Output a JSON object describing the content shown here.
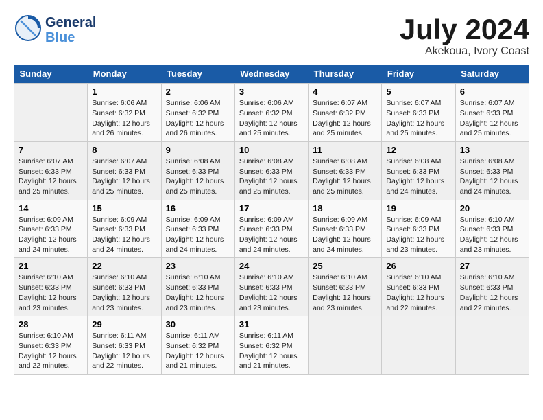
{
  "header": {
    "logo_line1": "General",
    "logo_line2": "Blue",
    "month_title": "July 2024",
    "location": "Akekoua, Ivory Coast"
  },
  "days_of_week": [
    "Sunday",
    "Monday",
    "Tuesday",
    "Wednesday",
    "Thursday",
    "Friday",
    "Saturday"
  ],
  "weeks": [
    [
      {
        "day": "",
        "sunrise": "",
        "sunset": "",
        "daylight": ""
      },
      {
        "day": "1",
        "sunrise": "Sunrise: 6:06 AM",
        "sunset": "Sunset: 6:32 PM",
        "daylight": "Daylight: 12 hours and 26 minutes."
      },
      {
        "day": "2",
        "sunrise": "Sunrise: 6:06 AM",
        "sunset": "Sunset: 6:32 PM",
        "daylight": "Daylight: 12 hours and 26 minutes."
      },
      {
        "day": "3",
        "sunrise": "Sunrise: 6:06 AM",
        "sunset": "Sunset: 6:32 PM",
        "daylight": "Daylight: 12 hours and 25 minutes."
      },
      {
        "day": "4",
        "sunrise": "Sunrise: 6:07 AM",
        "sunset": "Sunset: 6:32 PM",
        "daylight": "Daylight: 12 hours and 25 minutes."
      },
      {
        "day": "5",
        "sunrise": "Sunrise: 6:07 AM",
        "sunset": "Sunset: 6:33 PM",
        "daylight": "Daylight: 12 hours and 25 minutes."
      },
      {
        "day": "6",
        "sunrise": "Sunrise: 6:07 AM",
        "sunset": "Sunset: 6:33 PM",
        "daylight": "Daylight: 12 hours and 25 minutes."
      }
    ],
    [
      {
        "day": "7",
        "sunrise": "Sunrise: 6:07 AM",
        "sunset": "Sunset: 6:33 PM",
        "daylight": "Daylight: 12 hours and 25 minutes."
      },
      {
        "day": "8",
        "sunrise": "Sunrise: 6:07 AM",
        "sunset": "Sunset: 6:33 PM",
        "daylight": "Daylight: 12 hours and 25 minutes."
      },
      {
        "day": "9",
        "sunrise": "Sunrise: 6:08 AM",
        "sunset": "Sunset: 6:33 PM",
        "daylight": "Daylight: 12 hours and 25 minutes."
      },
      {
        "day": "10",
        "sunrise": "Sunrise: 6:08 AM",
        "sunset": "Sunset: 6:33 PM",
        "daylight": "Daylight: 12 hours and 25 minutes."
      },
      {
        "day": "11",
        "sunrise": "Sunrise: 6:08 AM",
        "sunset": "Sunset: 6:33 PM",
        "daylight": "Daylight: 12 hours and 25 minutes."
      },
      {
        "day": "12",
        "sunrise": "Sunrise: 6:08 AM",
        "sunset": "Sunset: 6:33 PM",
        "daylight": "Daylight: 12 hours and 24 minutes."
      },
      {
        "day": "13",
        "sunrise": "Sunrise: 6:08 AM",
        "sunset": "Sunset: 6:33 PM",
        "daylight": "Daylight: 12 hours and 24 minutes."
      }
    ],
    [
      {
        "day": "14",
        "sunrise": "Sunrise: 6:09 AM",
        "sunset": "Sunset: 6:33 PM",
        "daylight": "Daylight: 12 hours and 24 minutes."
      },
      {
        "day": "15",
        "sunrise": "Sunrise: 6:09 AM",
        "sunset": "Sunset: 6:33 PM",
        "daylight": "Daylight: 12 hours and 24 minutes."
      },
      {
        "day": "16",
        "sunrise": "Sunrise: 6:09 AM",
        "sunset": "Sunset: 6:33 PM",
        "daylight": "Daylight: 12 hours and 24 minutes."
      },
      {
        "day": "17",
        "sunrise": "Sunrise: 6:09 AM",
        "sunset": "Sunset: 6:33 PM",
        "daylight": "Daylight: 12 hours and 24 minutes."
      },
      {
        "day": "18",
        "sunrise": "Sunrise: 6:09 AM",
        "sunset": "Sunset: 6:33 PM",
        "daylight": "Daylight: 12 hours and 24 minutes."
      },
      {
        "day": "19",
        "sunrise": "Sunrise: 6:09 AM",
        "sunset": "Sunset: 6:33 PM",
        "daylight": "Daylight: 12 hours and 23 minutes."
      },
      {
        "day": "20",
        "sunrise": "Sunrise: 6:10 AM",
        "sunset": "Sunset: 6:33 PM",
        "daylight": "Daylight: 12 hours and 23 minutes."
      }
    ],
    [
      {
        "day": "21",
        "sunrise": "Sunrise: 6:10 AM",
        "sunset": "Sunset: 6:33 PM",
        "daylight": "Daylight: 12 hours and 23 minutes."
      },
      {
        "day": "22",
        "sunrise": "Sunrise: 6:10 AM",
        "sunset": "Sunset: 6:33 PM",
        "daylight": "Daylight: 12 hours and 23 minutes."
      },
      {
        "day": "23",
        "sunrise": "Sunrise: 6:10 AM",
        "sunset": "Sunset: 6:33 PM",
        "daylight": "Daylight: 12 hours and 23 minutes."
      },
      {
        "day": "24",
        "sunrise": "Sunrise: 6:10 AM",
        "sunset": "Sunset: 6:33 PM",
        "daylight": "Daylight: 12 hours and 23 minutes."
      },
      {
        "day": "25",
        "sunrise": "Sunrise: 6:10 AM",
        "sunset": "Sunset: 6:33 PM",
        "daylight": "Daylight: 12 hours and 23 minutes."
      },
      {
        "day": "26",
        "sunrise": "Sunrise: 6:10 AM",
        "sunset": "Sunset: 6:33 PM",
        "daylight": "Daylight: 12 hours and 22 minutes."
      },
      {
        "day": "27",
        "sunrise": "Sunrise: 6:10 AM",
        "sunset": "Sunset: 6:33 PM",
        "daylight": "Daylight: 12 hours and 22 minutes."
      }
    ],
    [
      {
        "day": "28",
        "sunrise": "Sunrise: 6:10 AM",
        "sunset": "Sunset: 6:33 PM",
        "daylight": "Daylight: 12 hours and 22 minutes."
      },
      {
        "day": "29",
        "sunrise": "Sunrise: 6:11 AM",
        "sunset": "Sunset: 6:33 PM",
        "daylight": "Daylight: 12 hours and 22 minutes."
      },
      {
        "day": "30",
        "sunrise": "Sunrise: 6:11 AM",
        "sunset": "Sunset: 6:32 PM",
        "daylight": "Daylight: 12 hours and 21 minutes."
      },
      {
        "day": "31",
        "sunrise": "Sunrise: 6:11 AM",
        "sunset": "Sunset: 6:32 PM",
        "daylight": "Daylight: 12 hours and 21 minutes."
      },
      {
        "day": "",
        "sunrise": "",
        "sunset": "",
        "daylight": ""
      },
      {
        "day": "",
        "sunrise": "",
        "sunset": "",
        "daylight": ""
      },
      {
        "day": "",
        "sunrise": "",
        "sunset": "",
        "daylight": ""
      }
    ]
  ]
}
